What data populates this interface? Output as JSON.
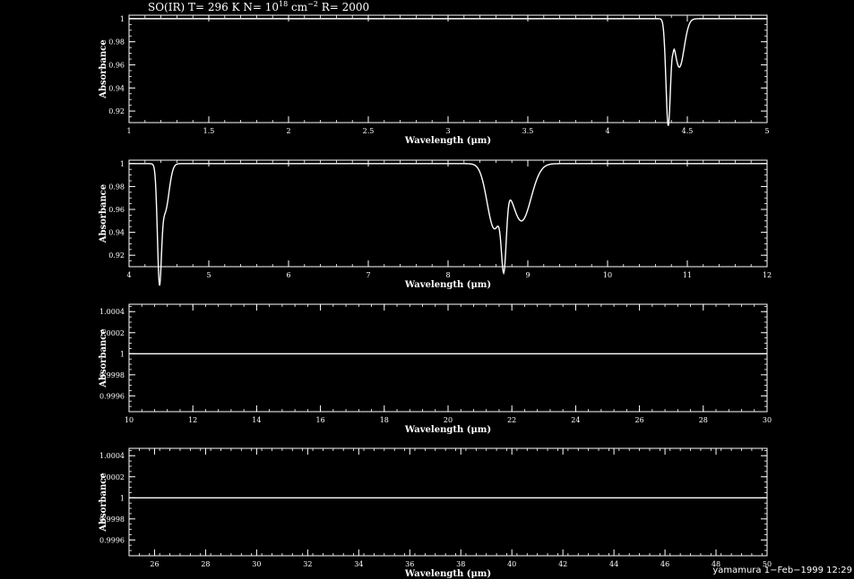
{
  "title": {
    "prefix": "SO(IR) T= 296 K N= 10",
    "exponent1": "18",
    "mid": " cm",
    "exponent2": "−2",
    "suffix": " R= 2000"
  },
  "stamp": "yamamura  1−Feb−1999 12:29",
  "colors": {
    "background": "#000000",
    "foreground": "#ffffff"
  },
  "chart_data": [
    {
      "type": "line",
      "xlabel": "Wavelength (μm)",
      "ylabel": "Absorbance",
      "xlim": [
        1,
        5
      ],
      "ylim": [
        0.91,
        1.003
      ],
      "xticks": [
        1,
        1.5,
        2,
        2.5,
        3,
        3.5,
        4,
        4.5,
        5
      ],
      "xtick_labels": [
        "1",
        "1.5",
        "2",
        "2.5",
        "3",
        "3.5",
        "4",
        "4.5",
        "5"
      ],
      "yticks": [
        0.92,
        0.94,
        0.96,
        0.98,
        1
      ],
      "ytick_labels": [
        "0.92",
        "0.94",
        "0.96",
        "0.98",
        "1"
      ],
      "baseline": 1,
      "features": [
        {
          "center": 4.38,
          "width": 0.014,
          "depth": 0.09
        },
        {
          "center": 4.45,
          "width": 0.03,
          "depth": 0.042
        },
        {
          "center": 4.41,
          "width": 0.004,
          "depth": 0.004
        }
      ]
    },
    {
      "type": "line",
      "xlabel": "Wavelength (μm)",
      "ylabel": "Absorbance",
      "xlim": [
        4,
        12
      ],
      "ylim": [
        0.91,
        1.003
      ],
      "xticks": [
        4,
        5,
        6,
        7,
        8,
        9,
        10,
        11,
        12
      ],
      "xtick_labels": [
        "4",
        "5",
        "6",
        "7",
        "8",
        "9",
        "10",
        "11",
        "12"
      ],
      "yticks": [
        0.92,
        0.94,
        0.96,
        0.98,
        1
      ],
      "ytick_labels": [
        "0.92",
        "0.94",
        "0.96",
        "0.98",
        "1"
      ],
      "baseline": 1,
      "features": [
        {
          "center": 4.38,
          "width": 0.025,
          "depth": 0.09
        },
        {
          "center": 4.45,
          "width": 0.05,
          "depth": 0.042
        },
        {
          "center": 8.58,
          "width": 0.09,
          "depth": 0.056
        },
        {
          "center": 8.7,
          "width": 0.03,
          "depth": 0.063
        },
        {
          "center": 8.92,
          "width": 0.12,
          "depth": 0.05
        }
      ]
    },
    {
      "type": "line",
      "xlabel": "Wavelength (μm)",
      "ylabel": "Absorbance",
      "xlim": [
        10,
        30
      ],
      "ylim": [
        0.99945,
        1.00047
      ],
      "xticks": [
        10,
        12,
        14,
        16,
        18,
        20,
        22,
        24,
        26,
        28,
        30
      ],
      "xtick_labels": [
        "10",
        "12",
        "14",
        "16",
        "18",
        "20",
        "22",
        "24",
        "26",
        "28",
        "30"
      ],
      "yticks": [
        0.9996,
        0.9998,
        1,
        1.0002,
        1.0004
      ],
      "ytick_labels": [
        "0.9996",
        "0.9998",
        "1",
        "1.0002",
        "1.0004"
      ],
      "baseline": 1,
      "features": []
    },
    {
      "type": "line",
      "xlabel": "Wavelength (μm)",
      "ylabel": "Absorbance",
      "xlim": [
        25,
        50
      ],
      "ylim": [
        0.99945,
        1.00047
      ],
      "xticks": [
        26,
        28,
        30,
        32,
        34,
        36,
        38,
        40,
        42,
        44,
        46,
        48,
        50
      ],
      "xtick_labels": [
        "26",
        "28",
        "30",
        "32",
        "34",
        "36",
        "38",
        "40",
        "42",
        "44",
        "46",
        "48",
        "50"
      ],
      "yticks": [
        0.9996,
        0.9998,
        1,
        1.0002,
        1.0004
      ],
      "ytick_labels": [
        "0.9996",
        "0.9998",
        "1",
        "1.0002",
        "1.0004"
      ],
      "baseline": 1,
      "features": []
    }
  ]
}
